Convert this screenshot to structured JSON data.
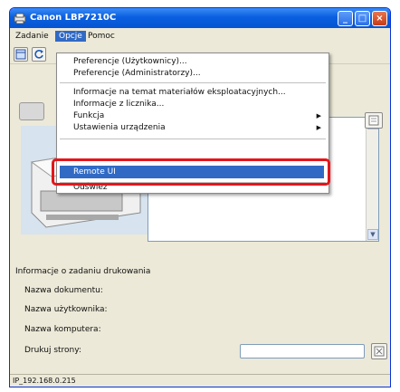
{
  "window": {
    "title": "Canon LBP7210C",
    "status_bar": "IP_192.168.0.215"
  },
  "menubar": {
    "items": [
      "Zadanie",
      "Opcje",
      "Pomoc"
    ],
    "active": "Opcje"
  },
  "dropdown": {
    "items": [
      {
        "label": "Preferencje (Użytkownicy)...",
        "submenu": false
      },
      {
        "label": "Preferencje (Administratorzy)...",
        "submenu": false
      },
      {
        "label": "Informacje na temat materiałów eksploatacyjnych...",
        "submenu": false
      },
      {
        "label": "Informacje z licznika...",
        "submenu": false
      },
      {
        "label": "Funkcja",
        "submenu": true
      },
      {
        "label": "Ustawienia urządzenia",
        "submenu": true
      },
      {
        "label": "Remote UI",
        "submenu": false
      },
      {
        "label": "Odśwież",
        "submenu": false
      }
    ],
    "highlighted": "Remote UI"
  },
  "job_info": {
    "heading": "Informacje o zadaniu drukowania",
    "document_name_label": "Nazwa dokumentu:",
    "user_name_label": "Nazwa użytkownika:",
    "computer_name_label": "Nazwa komputera:",
    "print_pages_label": "Drukuj strony:"
  },
  "colors": {
    "titlebar": "#0a5fe0",
    "highlight": "#316ac5",
    "callout": "#e3161b"
  }
}
